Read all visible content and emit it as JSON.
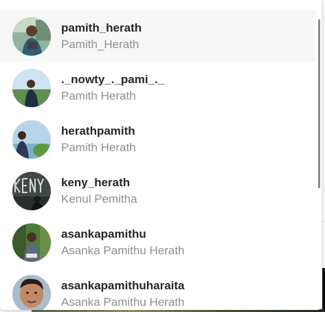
{
  "accounts": [
    {
      "username": "pamith_herath",
      "fullname": "Pamith_Herath",
      "avatar_icon": "profile-photo"
    },
    {
      "username": "._nowty_._pami_._",
      "fullname": "Pamith Herath",
      "avatar_icon": "profile-photo"
    },
    {
      "username": "herathpamith",
      "fullname": "Pamith Herath",
      "avatar_icon": "profile-photo"
    },
    {
      "username": "keny_herath",
      "fullname": "Kenul Pemitha",
      "avatar_icon": "profile-photo"
    },
    {
      "username": "asankapamithu",
      "fullname": "Asanka Pamithu Herath",
      "avatar_icon": "profile-photo"
    },
    {
      "username": "asankapamithuharaita",
      "fullname": "Asanka Pamithu Herath",
      "avatar_icon": "profile-photo"
    }
  ],
  "colors": {
    "selected_row": "#f7f7f7",
    "username_text": "#262626",
    "fullname_text": "#8e8e8e",
    "scrollbar": "#8a8a8a"
  }
}
